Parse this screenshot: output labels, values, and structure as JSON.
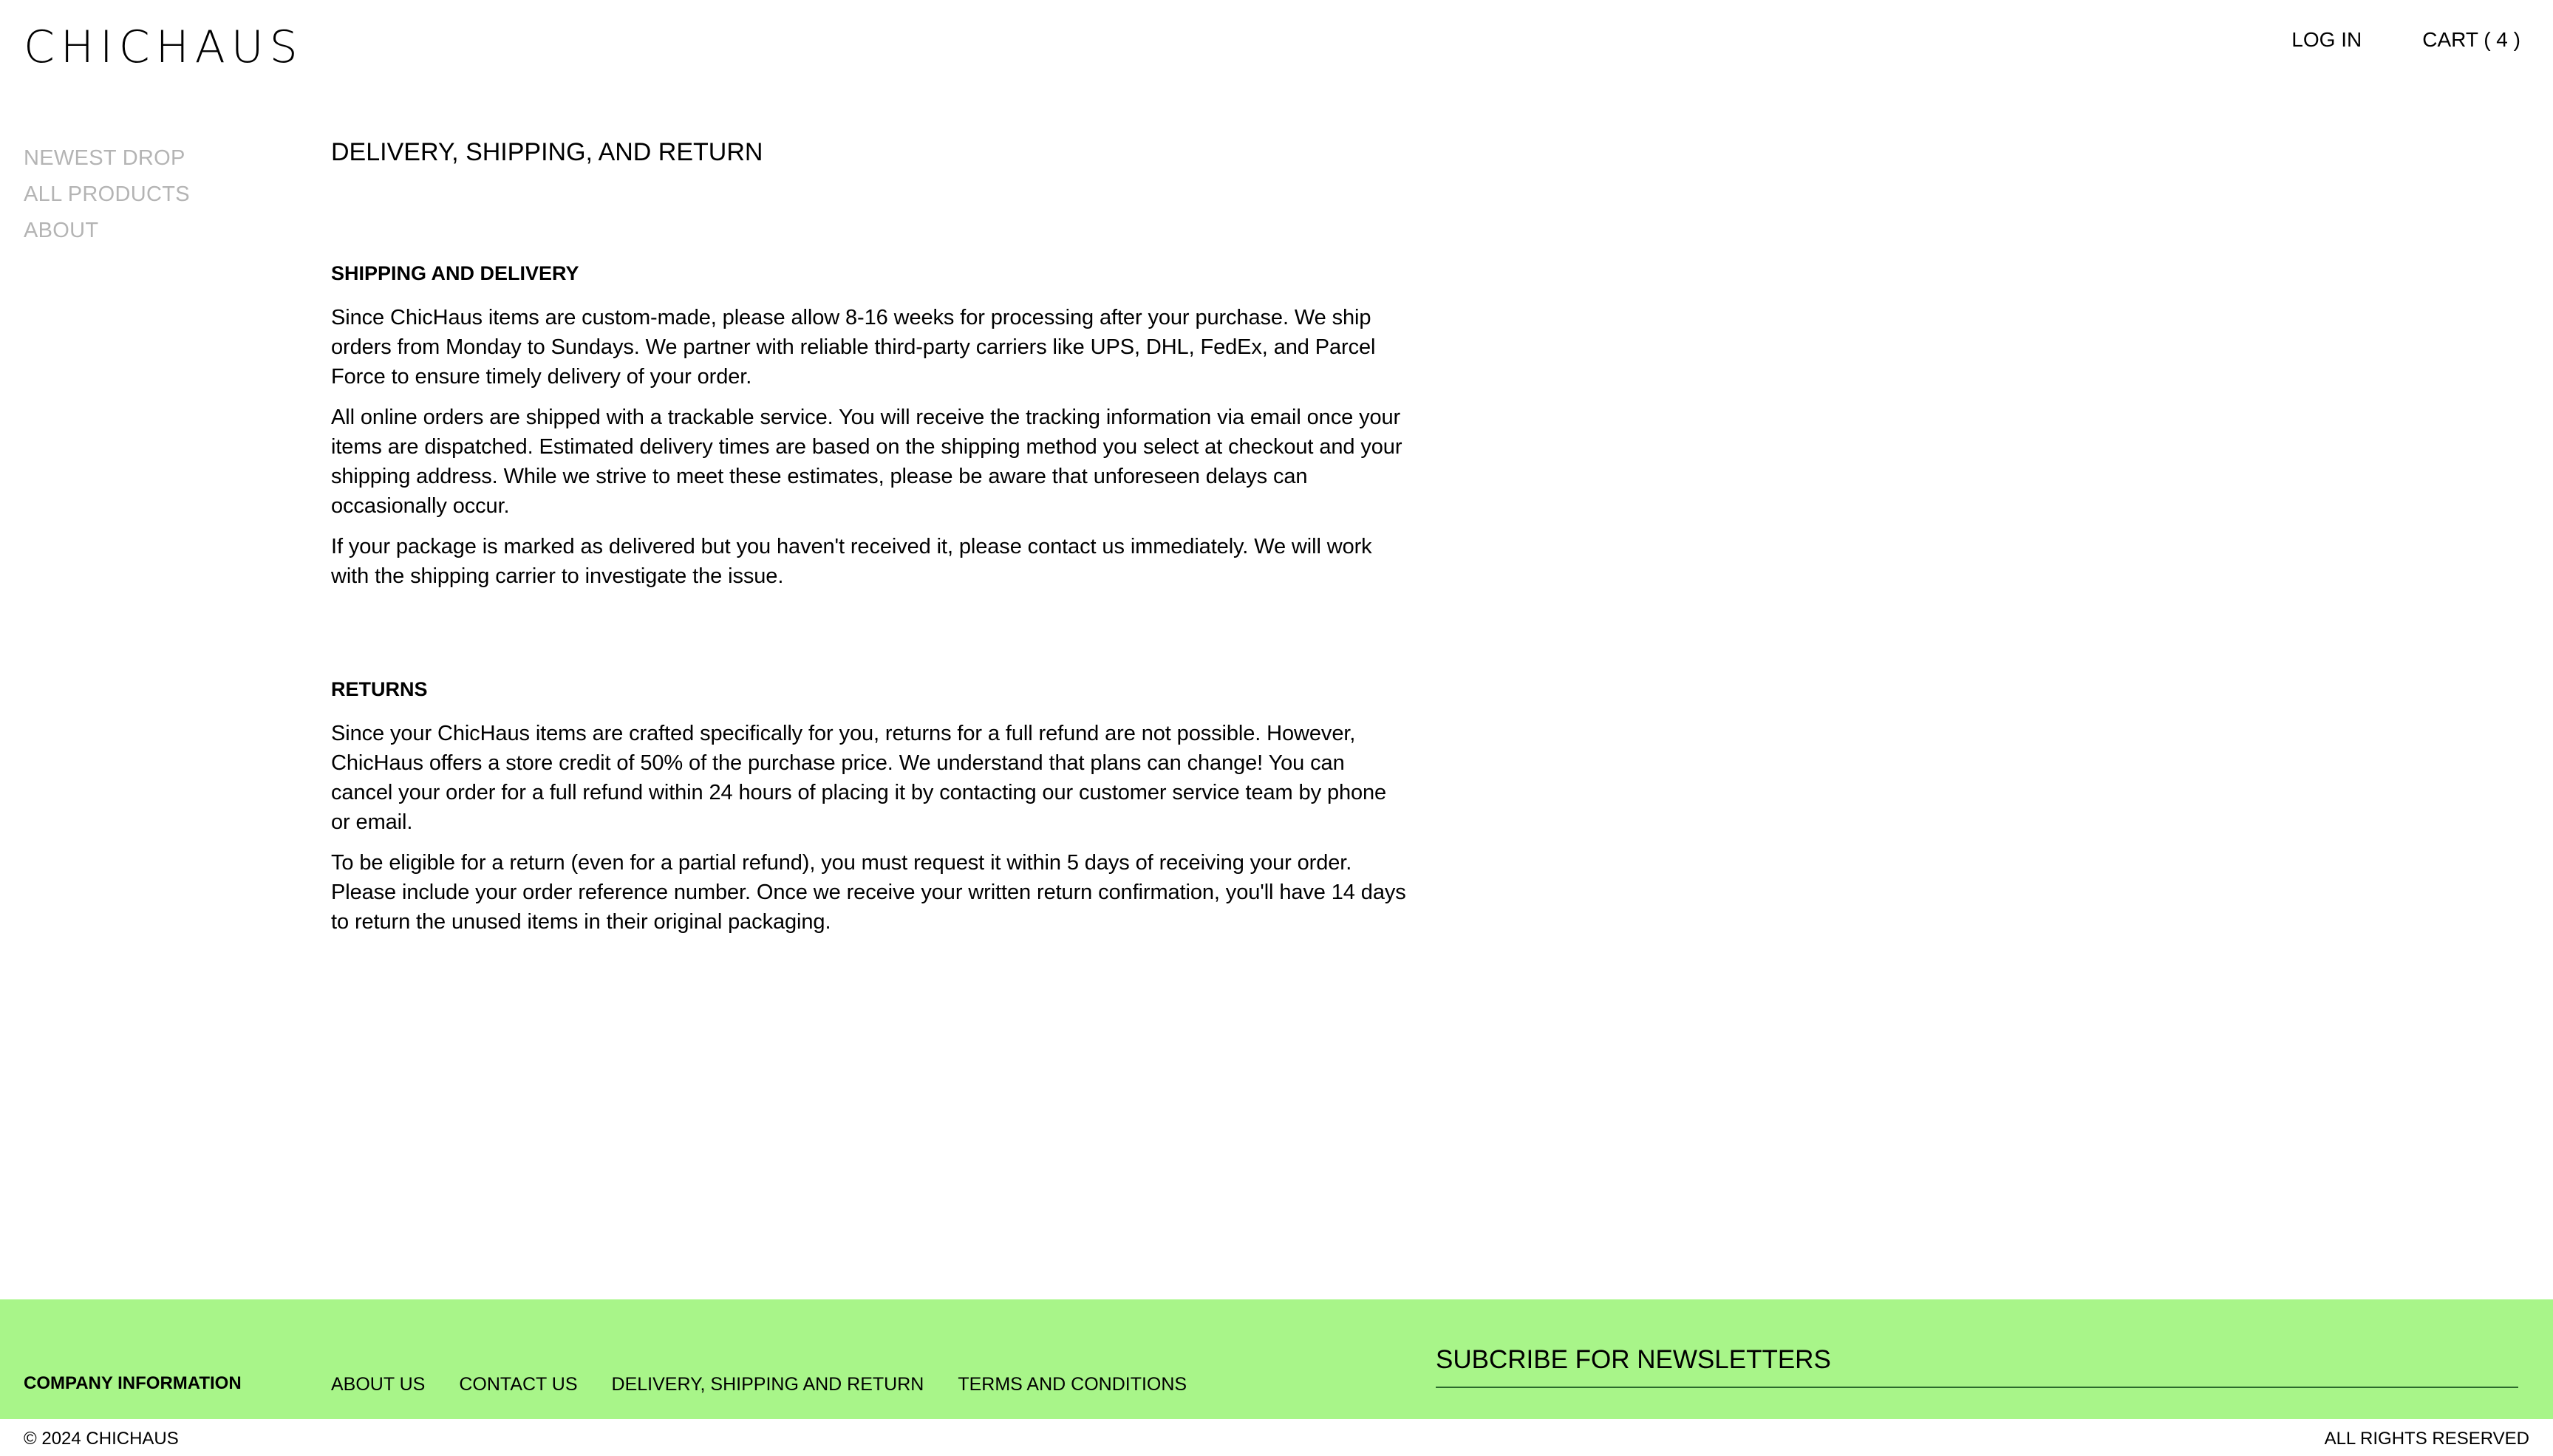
{
  "header": {
    "logo": "CHICHAUS",
    "login_label": "LOG IN",
    "cart_label": "CART ( 4 )"
  },
  "sidebar": {
    "items": [
      {
        "label": "NEWEST DROP"
      },
      {
        "label": "ALL PRODUCTS"
      },
      {
        "label": "ABOUT"
      }
    ]
  },
  "main": {
    "title": "DELIVERY, SHIPPING, AND RETURN",
    "sections": [
      {
        "heading": "SHIPPING AND DELIVERY",
        "paragraphs": [
          "Since ChicHaus items are custom-made, please allow 8-16 weeks for processing after your purchase. We ship orders from Monday to Sundays. We partner with reliable third-party carriers like UPS, DHL, FedEx, and Parcel Force to ensure timely delivery of your order.",
          "All online orders are shipped with a trackable service. You will receive the tracking information via email once your items are dispatched. Estimated delivery times are based on the shipping method you select at checkout and your shipping address. While we strive to meet these estimates, please be aware that unforeseen delays can occasionally occur.",
          "If your package is marked as delivered but you haven't received it, please contact us immediately. We will work with the shipping carrier to investigate the issue."
        ]
      },
      {
        "heading": "RETURNS",
        "paragraphs": [
          "Since your ChicHaus items are crafted specifically for you, returns for a full refund are not possible. However, ChicHaus offers a store credit of 50% of the purchase price. We understand that plans can change! You can cancel your order for a full refund within 24 hours of placing it by contacting our customer service team by phone or email.",
          "To be eligible for a return (even for a partial refund), you must request it within 5 days of receiving your order. Please include your order reference number. Once we receive your written return confirmation, you'll have 14 days to return the unused items in their original packaging."
        ]
      }
    ]
  },
  "footer": {
    "company_label": "COMPANY INFORMATION",
    "links": [
      {
        "label": "ABOUT US"
      },
      {
        "label": "CONTACT US"
      },
      {
        "label": "DELIVERY, SHIPPING AND RETURN"
      },
      {
        "label": "TERMS AND CONDITIONS"
      }
    ],
    "newsletter_title": "SUBCRIBE FOR NEWSLETTERS",
    "copyright": "© 2024 CHICHAUS",
    "rights": "ALL RIGHTS RESERVED"
  },
  "colors": {
    "footer_bg": "#a8f589",
    "sidebar_text": "#b4b4b4",
    "text": "#000000"
  }
}
